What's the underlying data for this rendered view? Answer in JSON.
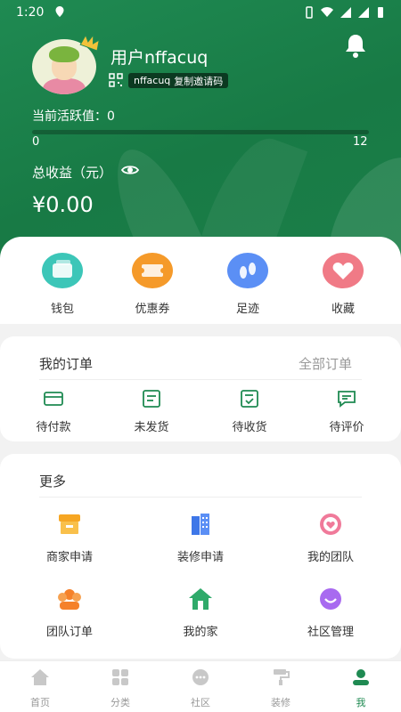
{
  "status_bar": {
    "time": "1:20"
  },
  "profile": {
    "username": "用户nffacuq",
    "invite_code": "nffacuq",
    "copy_invite_label": "复制邀请码",
    "activity_label": "当前活跃值：0",
    "activity_value": 0,
    "progress_min": "0",
    "progress_max": "12",
    "earnings_label": "总收益（元）",
    "earnings_value": "¥0.00"
  },
  "quick_actions": [
    {
      "label": "钱包",
      "icon": "wallet-icon",
      "color": "#3cc6b8"
    },
    {
      "label": "优惠券",
      "icon": "coupon-icon",
      "color": "#f59a2a"
    },
    {
      "label": "足迹",
      "icon": "footprint-icon",
      "color": "#5b8ff5"
    },
    {
      "label": "收藏",
      "icon": "heart-icon",
      "color": "#f07a86"
    }
  ],
  "orders": {
    "title": "我的订单",
    "all_label": "全部订单",
    "items": [
      {
        "label": "待付款",
        "icon": "card-icon"
      },
      {
        "label": "未发货",
        "icon": "list-icon"
      },
      {
        "label": "待收货",
        "icon": "receive-icon"
      },
      {
        "label": "待评价",
        "icon": "comment-icon"
      }
    ]
  },
  "more": {
    "title": "更多",
    "items": [
      {
        "label": "商家申请",
        "icon": "shop-icon"
      },
      {
        "label": "装修申请",
        "icon": "building-icon"
      },
      {
        "label": "我的团队",
        "icon": "team-heart-icon"
      },
      {
        "label": "团队订单",
        "icon": "team-icon"
      },
      {
        "label": "我的家",
        "icon": "home-icon"
      },
      {
        "label": "社区管理",
        "icon": "community-icon"
      }
    ]
  },
  "tabs": [
    {
      "label": "首页",
      "icon": "home-tab-icon"
    },
    {
      "label": "分类",
      "icon": "grid-icon"
    },
    {
      "label": "社区",
      "icon": "chat-icon"
    },
    {
      "label": "装修",
      "icon": "paint-roller-icon"
    },
    {
      "label": "我",
      "icon": "person-icon"
    }
  ],
  "colors": {
    "brand": "#1f8a52",
    "active_tab": "#1f8a52"
  }
}
